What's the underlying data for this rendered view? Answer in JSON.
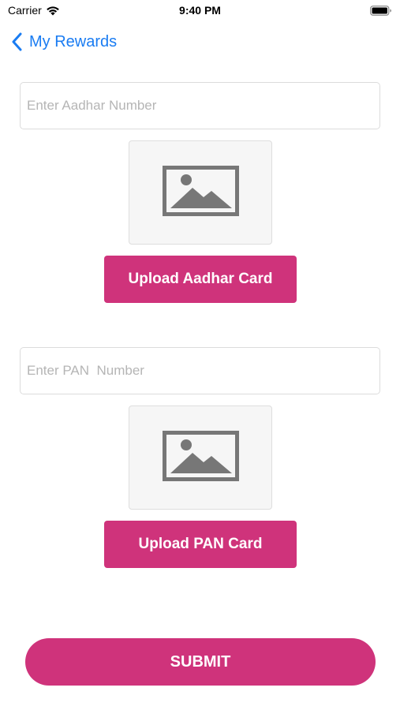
{
  "status_bar": {
    "carrier": "Carrier",
    "time": "9:40 PM",
    "wifi_icon": "wifi-icon",
    "battery_icon": "battery-icon"
  },
  "nav": {
    "back_label": "My Rewards",
    "back_icon": "chevron-left-icon"
  },
  "aadhar": {
    "placeholder": "Enter Aadhar Number",
    "value": "",
    "image_icon": "image-placeholder-icon",
    "upload_label": "Upload Aadhar Card"
  },
  "pan": {
    "placeholder": "Enter PAN  Number",
    "value": "",
    "image_icon": "image-placeholder-icon",
    "upload_label": "Upload PAN Card"
  },
  "submit_label": "SUBMIT",
  "colors": {
    "accent": "#cf337b",
    "link": "#1a7cf2",
    "placeholder_text": "#b5b5b5",
    "border": "#dcdcdc",
    "image_box_bg": "#f6f6f6",
    "image_icon": "#777777"
  }
}
